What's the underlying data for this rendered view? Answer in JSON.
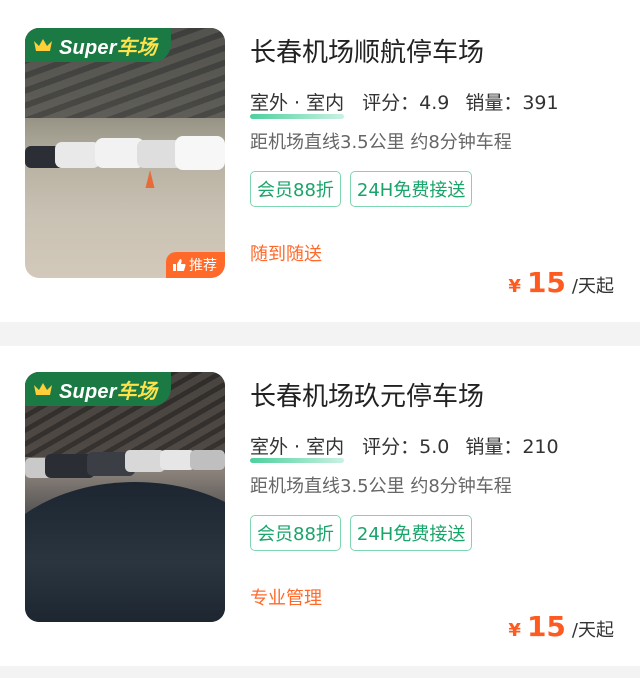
{
  "listings": [
    {
      "badge": {
        "prefix": "Super",
        "suffix": "车场"
      },
      "recommend_label": "推荐",
      "title": "长春机场顺航停车场",
      "type": "室外 · 室内",
      "rating_label": "评分：4.9",
      "sales_label": "销量：391",
      "distance": "距机场直线3.5公里 约8分钟车程",
      "tags": [
        "会员88折",
        "24H免费接送"
      ],
      "note": "随到随送",
      "price": {
        "currency": "¥",
        "value": "15",
        "unit": "/天起"
      }
    },
    {
      "badge": {
        "prefix": "Super",
        "suffix": "车场"
      },
      "title": "长春机场玖元停车场",
      "type": "室外 · 室内",
      "rating_label": "评分：5.0",
      "sales_label": "销量：210",
      "distance": "距机场直线3.5公里 约8分钟车程",
      "tags": [
        "会员88折",
        "24H免费接送"
      ],
      "note": "专业管理",
      "price": {
        "currency": "¥",
        "value": "15",
        "unit": "/天起"
      }
    }
  ],
  "colors": {
    "brand_green": "#1b7a44",
    "accent_orange": "#ff6a2b",
    "tag_green": "#19a46a",
    "badge_yellow": "#ffe14a"
  }
}
